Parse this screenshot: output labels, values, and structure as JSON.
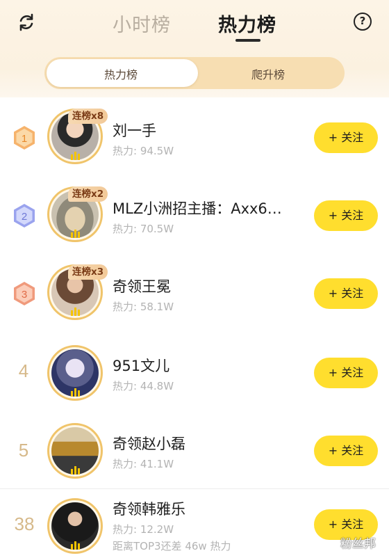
{
  "header": {
    "tabs": [
      {
        "label": "小时榜",
        "active": false
      },
      {
        "label": "热力榜",
        "active": true
      }
    ],
    "refresh_icon": "refresh-icon",
    "help_icon": "help-icon",
    "help_symbol": "?"
  },
  "segment": {
    "options": [
      "热力榜",
      "爬升榜"
    ],
    "selected": "热力榜"
  },
  "rows": [
    {
      "rank": "1",
      "name": "刘一手",
      "heat": "热力: 94.5W",
      "streak": "连榜x8",
      "follow": "+ 关注"
    },
    {
      "rank": "2",
      "name": "MLZ小洲招主播：Axx6…",
      "heat": "热力: 70.5W",
      "streak": "连榜x2",
      "follow": "+ 关注"
    },
    {
      "rank": "3",
      "name": "奇领王冕",
      "heat": "热力: 58.1W",
      "streak": "连榜x3",
      "follow": "+ 关注"
    },
    {
      "rank": "4",
      "name": "951文儿",
      "heat": "热力: 44.8W",
      "follow": "+ 关注"
    },
    {
      "rank": "5",
      "name": "奇领赵小磊",
      "heat": "热力: 41.1W",
      "follow": "+ 关注"
    }
  ],
  "self_row": {
    "rank": "38",
    "name": "奇领韩雅乐",
    "heat": "热力: 12.2W",
    "gap": "距离TOP3还差 46w 热力",
    "follow": "+ 关注"
  },
  "watermark": "粉丝邦",
  "colors": {
    "accent_yellow": "#ffde2e",
    "gold_ring": "#f0c46a",
    "rank1": "#f4a052",
    "rank2": "#8d97e8",
    "rank3": "#ee8b6a",
    "rank_plain": "#d6b98a"
  }
}
